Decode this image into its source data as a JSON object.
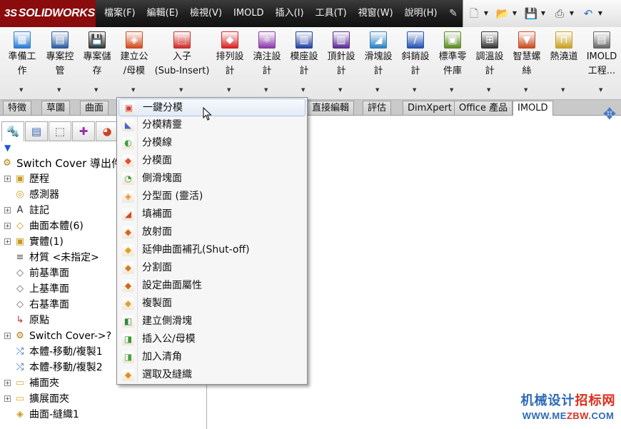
{
  "app": {
    "logo_text": "SOLIDWORKS",
    "logo_prefix": "3S"
  },
  "menubar": {
    "items": [
      "檔案(F)",
      "編輯(E)",
      "檢視(V)",
      "IMOLD",
      "插入(I)",
      "工具(T)",
      "視窗(W)",
      "說明(H)"
    ]
  },
  "quickbar": {
    "icons": [
      "new-document-icon",
      "open-folder-icon",
      "save-icon",
      "print-icon",
      "undo-icon"
    ]
  },
  "ribbon": {
    "buttons": [
      {
        "label": "準備工\n作",
        "icon": "prepare-icon",
        "color": "#2a7ad1"
      },
      {
        "label": "專案控\n管",
        "icon": "project-control-icon",
        "color": "#2c5aa0"
      },
      {
        "label": "專案儲\n存",
        "icon": "project-save-icon",
        "color": "#333333"
      },
      {
        "label": "建立公\n/母模",
        "icon": "core-cavity-icon",
        "color": "#d04a1a"
      },
      {
        "label": "入子\n(Sub-Insert)",
        "icon": "sub-insert-icon",
        "color": "#cf2a2a"
      },
      {
        "label": "排列設\n計",
        "icon": "layout-design-icon",
        "color": "#d72020"
      },
      {
        "label": "澆注設\n計",
        "icon": "feed-design-icon",
        "color": "#8a3aa8"
      },
      {
        "label": "模座設\n計",
        "icon": "mold-base-icon",
        "color": "#2040a0"
      },
      {
        "label": "頂針設\n計",
        "icon": "ejector-design-icon",
        "color": "#5a2a90"
      },
      {
        "label": "滑塊設\n計",
        "icon": "slider-design-icon",
        "color": "#2a80c0"
      },
      {
        "label": "斜銷設\n計",
        "icon": "lifter-design-icon",
        "color": "#2050b0"
      },
      {
        "label": "標準零\n件庫",
        "icon": "standard-parts-icon",
        "color": "#5a8a20"
      },
      {
        "label": "調溫設\n計",
        "icon": "cooling-design-icon",
        "color": "#333333"
      },
      {
        "label": "智慧螺\n絲",
        "icon": "smart-screw-icon",
        "color": "#c84a20"
      },
      {
        "label": "熱澆道",
        "icon": "hot-runner-icon",
        "color": "#c8a020"
      },
      {
        "label": "IMOLD\n工程...",
        "icon": "imold-project-icon",
        "color": "#666666"
      }
    ]
  },
  "tabs": [
    {
      "label": "特徵"
    },
    {
      "label": "草圖"
    },
    {
      "label": "曲面"
    },
    {
      "label": "直接編輯"
    },
    {
      "label": "評估"
    },
    {
      "label": "DimXpert"
    },
    {
      "label": "Office 產品"
    },
    {
      "label": "IMOLD",
      "active": true
    }
  ],
  "panel": {
    "tab_icons": [
      "feature-manager-icon",
      "property-manager-icon",
      "configuration-manager-icon",
      "dimxpert-manager-icon",
      "display-manager-icon"
    ],
    "filter_icon": "filter-icon",
    "tree": [
      {
        "label": "Switch Cover 導出件",
        "icon": "part-icon",
        "root": true
      },
      {
        "label": "歷程",
        "icon": "history-folder-icon",
        "expand": true
      },
      {
        "label": "感測器",
        "icon": "sensor-icon"
      },
      {
        "label": "註記",
        "icon": "annotation-icon",
        "expand": true
      },
      {
        "label": "曲面本體(6)",
        "icon": "surface-body-icon",
        "expand": true
      },
      {
        "label": "實體(1)",
        "icon": "solid-body-icon",
        "expand": true
      },
      {
        "label": "材質 <未指定>",
        "icon": "material-icon"
      },
      {
        "label": "前基準面",
        "icon": "plane-icon"
      },
      {
        "label": "上基準面",
        "icon": "plane-icon"
      },
      {
        "label": "右基準面",
        "icon": "plane-icon"
      },
      {
        "label": "原點",
        "icon": "origin-icon"
      },
      {
        "label": "Switch Cover->?",
        "icon": "part-ref-icon",
        "expand": true
      },
      {
        "label": "本體-移動/複製1",
        "icon": "move-copy-icon"
      },
      {
        "label": "本體-移動/複製2",
        "icon": "move-copy-icon"
      },
      {
        "label": "補面夾",
        "icon": "folder-icon",
        "expand": true
      },
      {
        "label": "擴展面夾",
        "icon": "folder-icon",
        "expand": true
      },
      {
        "label": "曲面-縫織1",
        "icon": "knit-surface-icon"
      }
    ]
  },
  "dropdown": {
    "items": [
      {
        "label": "一鍵分模",
        "icon": "one-click-split-icon",
        "color": "#d04040",
        "hover": true
      },
      {
        "label": "分模精靈",
        "icon": "split-wizard-icon",
        "color": "#4a64c8"
      },
      {
        "label": "分模線",
        "icon": "parting-line-icon",
        "color": "#2fa040"
      },
      {
        "label": "分模面",
        "icon": "parting-surface-icon",
        "color": "#e05030"
      },
      {
        "label": "側滑塊面",
        "icon": "side-slider-face-icon",
        "color": "#3a9a3a"
      },
      {
        "label": "分型面 (靈活)",
        "icon": "flexible-parting-icon",
        "color": "#e0902a"
      },
      {
        "label": "填補面",
        "icon": "fill-surface-icon",
        "color": "#d04a2a"
      },
      {
        "label": "放射面",
        "icon": "radiate-surface-icon",
        "color": "#e06020"
      },
      {
        "label": "延伸曲面補孔(Shut-off)",
        "icon": "shutoff-icon",
        "color": "#e0a020"
      },
      {
        "label": "分割面",
        "icon": "split-face-icon",
        "color": "#d08020"
      },
      {
        "label": "設定曲面屬性",
        "icon": "surface-property-icon",
        "color": "#c86a20"
      },
      {
        "label": "複製面",
        "icon": "copy-face-icon",
        "color": "#e0a030"
      },
      {
        "label": "建立側滑塊",
        "icon": "create-slider-icon",
        "color": "#2f8a40"
      },
      {
        "label": "插入公/母模",
        "icon": "insert-core-cavity-icon",
        "color": "#3a9a3a"
      },
      {
        "label": "加入清角",
        "icon": "add-corner-relief-icon",
        "color": "#4aa040"
      },
      {
        "label": "選取及縫織",
        "icon": "select-knit-icon",
        "color": "#e09020"
      }
    ]
  },
  "watermark": {
    "line1_a": "机械设计",
    "line1_b": "招标网",
    "line2_a": "WWW.ME",
    "line2_b": "ZBW",
    "line2_c": ".COM"
  }
}
